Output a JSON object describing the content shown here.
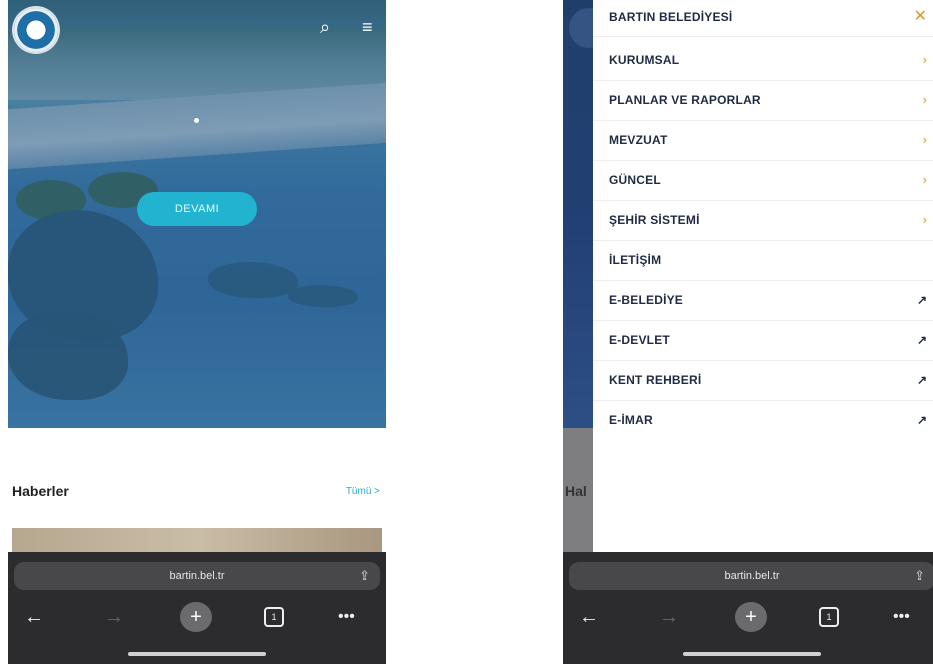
{
  "left": {
    "hero_button": "DEVAMI",
    "news_title": "Haberler",
    "news_all": "Tümü >",
    "url": "bartin.bel.tr",
    "tab_count": "1"
  },
  "right": {
    "partial_news_title": "Hal",
    "menu_title": "BARTIN BELEDİYESİ",
    "menu_items": [
      {
        "label": "KURUMSAL",
        "icon": "chevron-right"
      },
      {
        "label": "PLANLAR VE RAPORLAR",
        "icon": "chevron-right"
      },
      {
        "label": "MEVZUAT",
        "icon": "chevron-right"
      },
      {
        "label": "GÜNCEL",
        "icon": "chevron-right"
      },
      {
        "label": "ŞEHİR SİSTEMİ",
        "icon": "chevron-right"
      },
      {
        "label": "İLETİŞİM",
        "icon": "none"
      },
      {
        "label": "E-BELEDİYE",
        "icon": "external-arrow"
      },
      {
        "label": "E-DEVLET",
        "icon": "external-arrow"
      },
      {
        "label": "KENT REHBERİ",
        "icon": "external-arrow"
      },
      {
        "label": "E-İMAR",
        "icon": "external-arrow"
      }
    ],
    "url": "bartin.bel.tr",
    "tab_count": "1"
  },
  "colors": {
    "accent_button": "#22b3d0",
    "menu_chevron": "#d89a2c",
    "menu_text": "#1f2a44",
    "browser_bar": "#2c2c2e"
  }
}
